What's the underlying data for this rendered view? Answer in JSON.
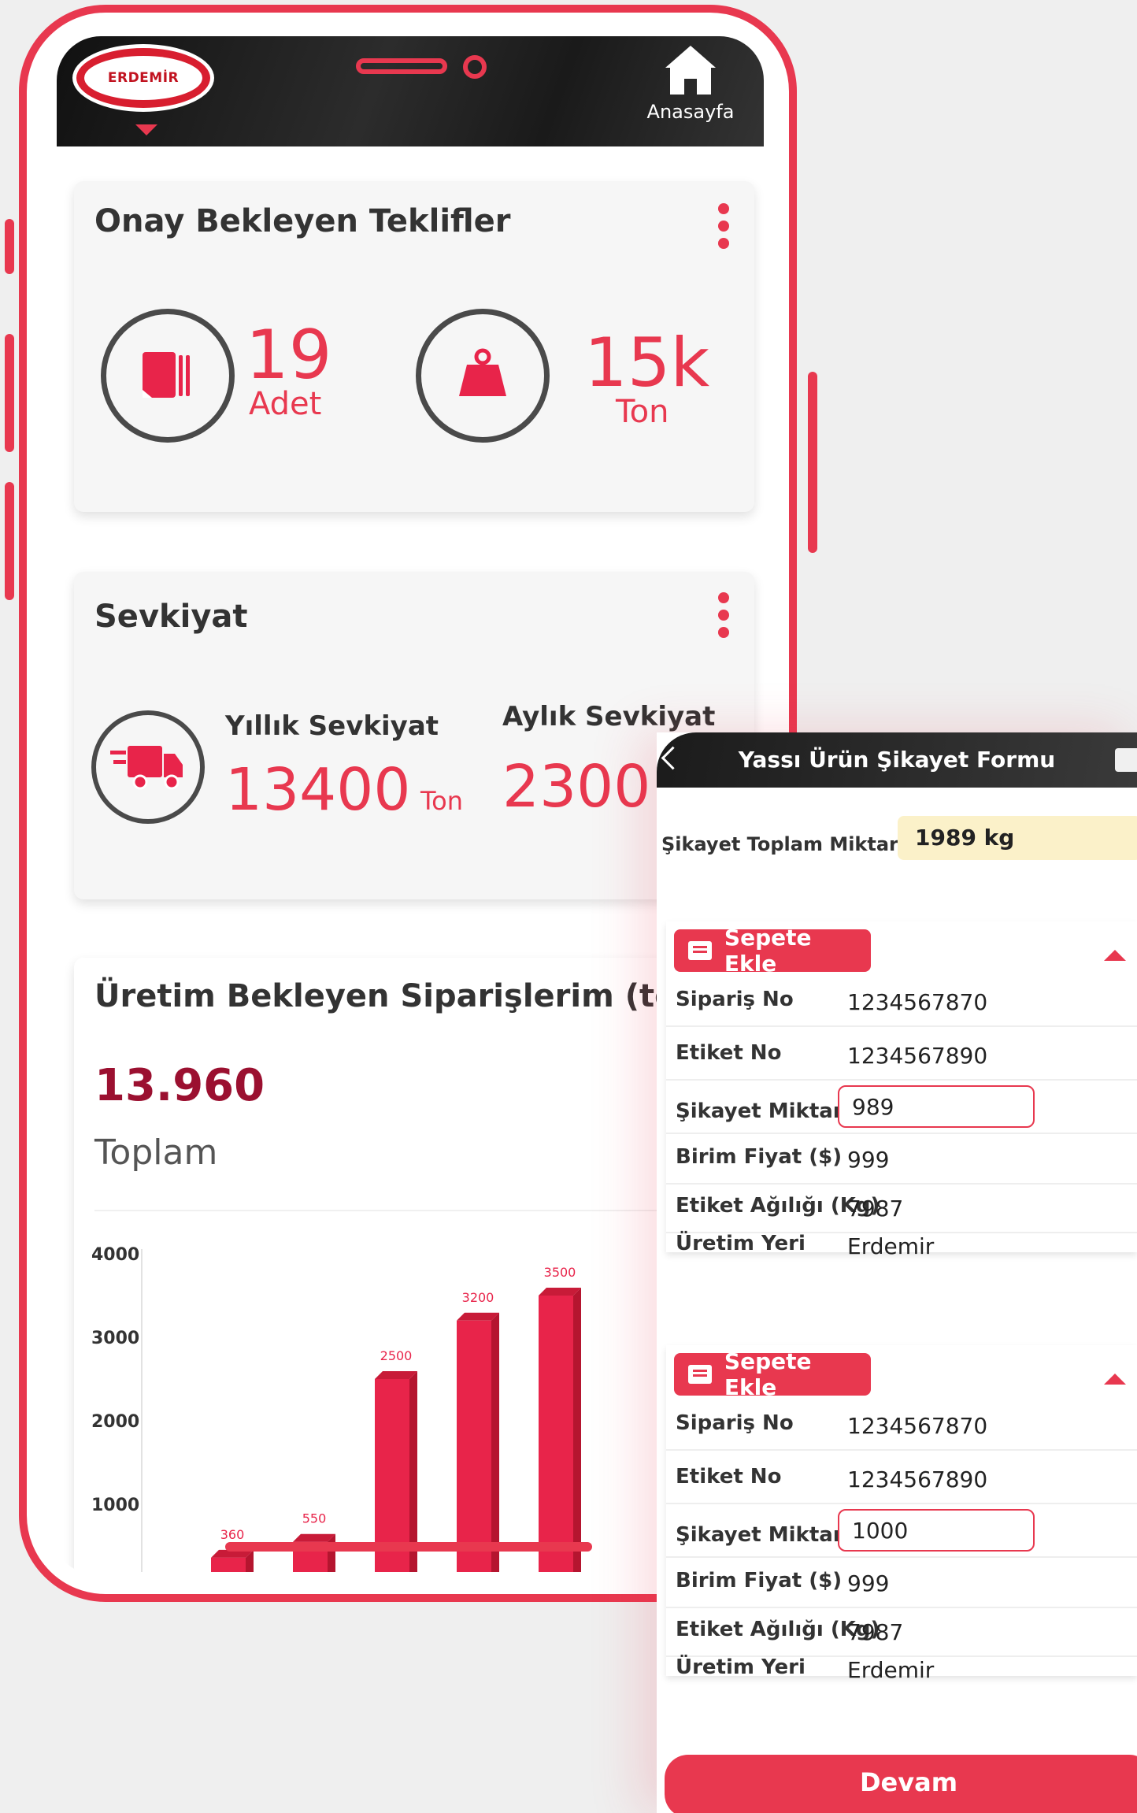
{
  "header": {
    "logo_text": "ERDEMİR",
    "home_label": "Anasayfa"
  },
  "offers_card": {
    "title": "Onay Bekleyen Teklifler",
    "count_value": "19",
    "count_unit": "Adet",
    "weight_value": "15k",
    "weight_unit": "Ton"
  },
  "shipment_card": {
    "title": "Sevkiyat",
    "yearly_label": "Yıllık Sevkiyat",
    "yearly_value": "13400",
    "yearly_unit": "Ton",
    "monthly_label": "Aylık Sevkiyat",
    "monthly_value": "2300"
  },
  "orders_card": {
    "title": "Üretim Bekleyen Siparişlerim (ton)",
    "total_value": "13.960",
    "total_label": "Toplam"
  },
  "chart_data": {
    "type": "bar",
    "title": "",
    "ylim": [
      0,
      4000
    ],
    "y_ticks": [
      "1000",
      "2000",
      "3000",
      "4000"
    ],
    "values": [
      360,
      550,
      2500,
      3200,
      3500
    ],
    "value_labels": [
      "360",
      "550",
      "2500",
      "3200",
      "3500"
    ],
    "bar_color": "#e8244a"
  },
  "form": {
    "title": "Yassı Ürün Şikayet Formu",
    "total_label": "Şikayet Toplam Miktarı",
    "total_value": "1989 kg",
    "items": [
      {
        "add_label": "Sepete Ekle",
        "order_no_label": "Sipariş No",
        "order_no": "1234567870",
        "tag_no_label": "Etiket No",
        "tag_no": "1234567890",
        "complaint_qty_label": "Şikayet Miktarı (Kg)",
        "complaint_qty": "989",
        "unit_price_label": "Birim Fiyat ($)",
        "unit_price": "999",
        "tag_weight_label": "Etiket Ağılığı (Kg)",
        "tag_weight": "7987",
        "origin_label": "Üretim Yeri",
        "origin": "Erdemir"
      },
      {
        "add_label": "Sepete Ekle",
        "order_no_label": "Sipariş No",
        "order_no": "1234567870",
        "tag_no_label": "Etiket No",
        "tag_no": "1234567890",
        "complaint_qty_label": "Şikayet Miktarı (Kg)",
        "complaint_qty": "1000",
        "unit_price_label": "Birim Fiyat ($)",
        "unit_price": "999",
        "tag_weight_label": "Etiket Ağılığı (Kg)",
        "tag_weight": "7987",
        "origin_label": "Üretim Yeri",
        "origin": "Erdemir"
      }
    ],
    "continue_label": "Devam"
  },
  "colors": {
    "accent": "#e8384f",
    "dark_value": "#9b1030",
    "highlight": "#fbf1c9"
  }
}
